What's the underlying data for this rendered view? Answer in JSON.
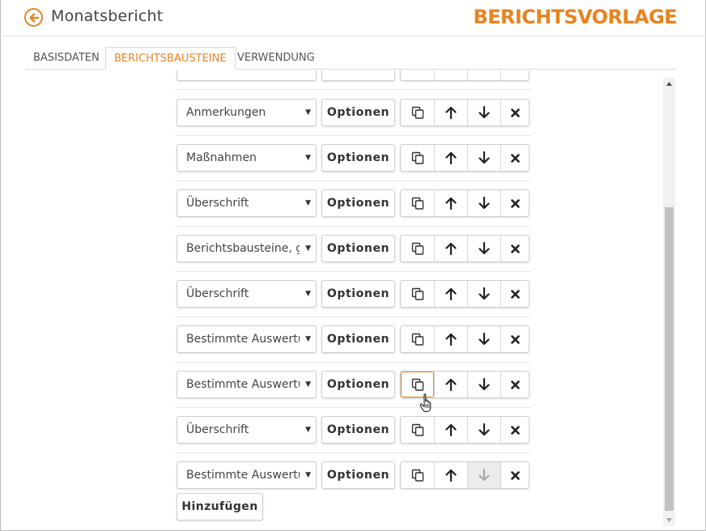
{
  "header": {
    "title": "Monatsbericht",
    "brand": "BERICHTSVORLAGE"
  },
  "tabs": [
    {
      "label": "BASISDATEN",
      "active": false
    },
    {
      "label": "BERICHTSBAUSTEINE",
      "active": true
    },
    {
      "label": "VERWENDUNG",
      "active": false
    }
  ],
  "rows": [
    {
      "select": "Anmerkungen",
      "options_label": "Optionen",
      "down_disabled": false
    },
    {
      "select": "Maßnahmen",
      "options_label": "Optionen",
      "down_disabled": false
    },
    {
      "select": "Überschrift",
      "options_label": "Optionen",
      "down_disabled": false
    },
    {
      "select": "Berichtsbausteine, gruppiert",
      "options_label": "Optionen",
      "down_disabled": false
    },
    {
      "select": "Überschrift",
      "options_label": "Optionen",
      "down_disabled": false
    },
    {
      "select": "Bestimmte Auswertung",
      "options_label": "Optionen",
      "down_disabled": false
    },
    {
      "select": "Bestimmte Auswertung",
      "options_label": "Optionen",
      "down_disabled": false,
      "copy_hover": true
    },
    {
      "select": "Überschrift",
      "options_label": "Optionen",
      "down_disabled": false
    },
    {
      "select": "Bestimmte Auswertung",
      "options_label": "Optionen",
      "down_disabled": true
    }
  ],
  "add_button": "Hinzufügen",
  "colors": {
    "accent": "#e8841f",
    "text": "#333333",
    "border": "#cfcfcf",
    "disabled_bg": "#ececec"
  },
  "icons": {
    "back": "arrow-left-circle-icon",
    "copy": "copy-icon",
    "up": "arrow-up-icon",
    "down": "arrow-down-icon",
    "delete": "close-icon",
    "caret": "caret-down-icon",
    "cursor": "hand-pointer-icon"
  }
}
